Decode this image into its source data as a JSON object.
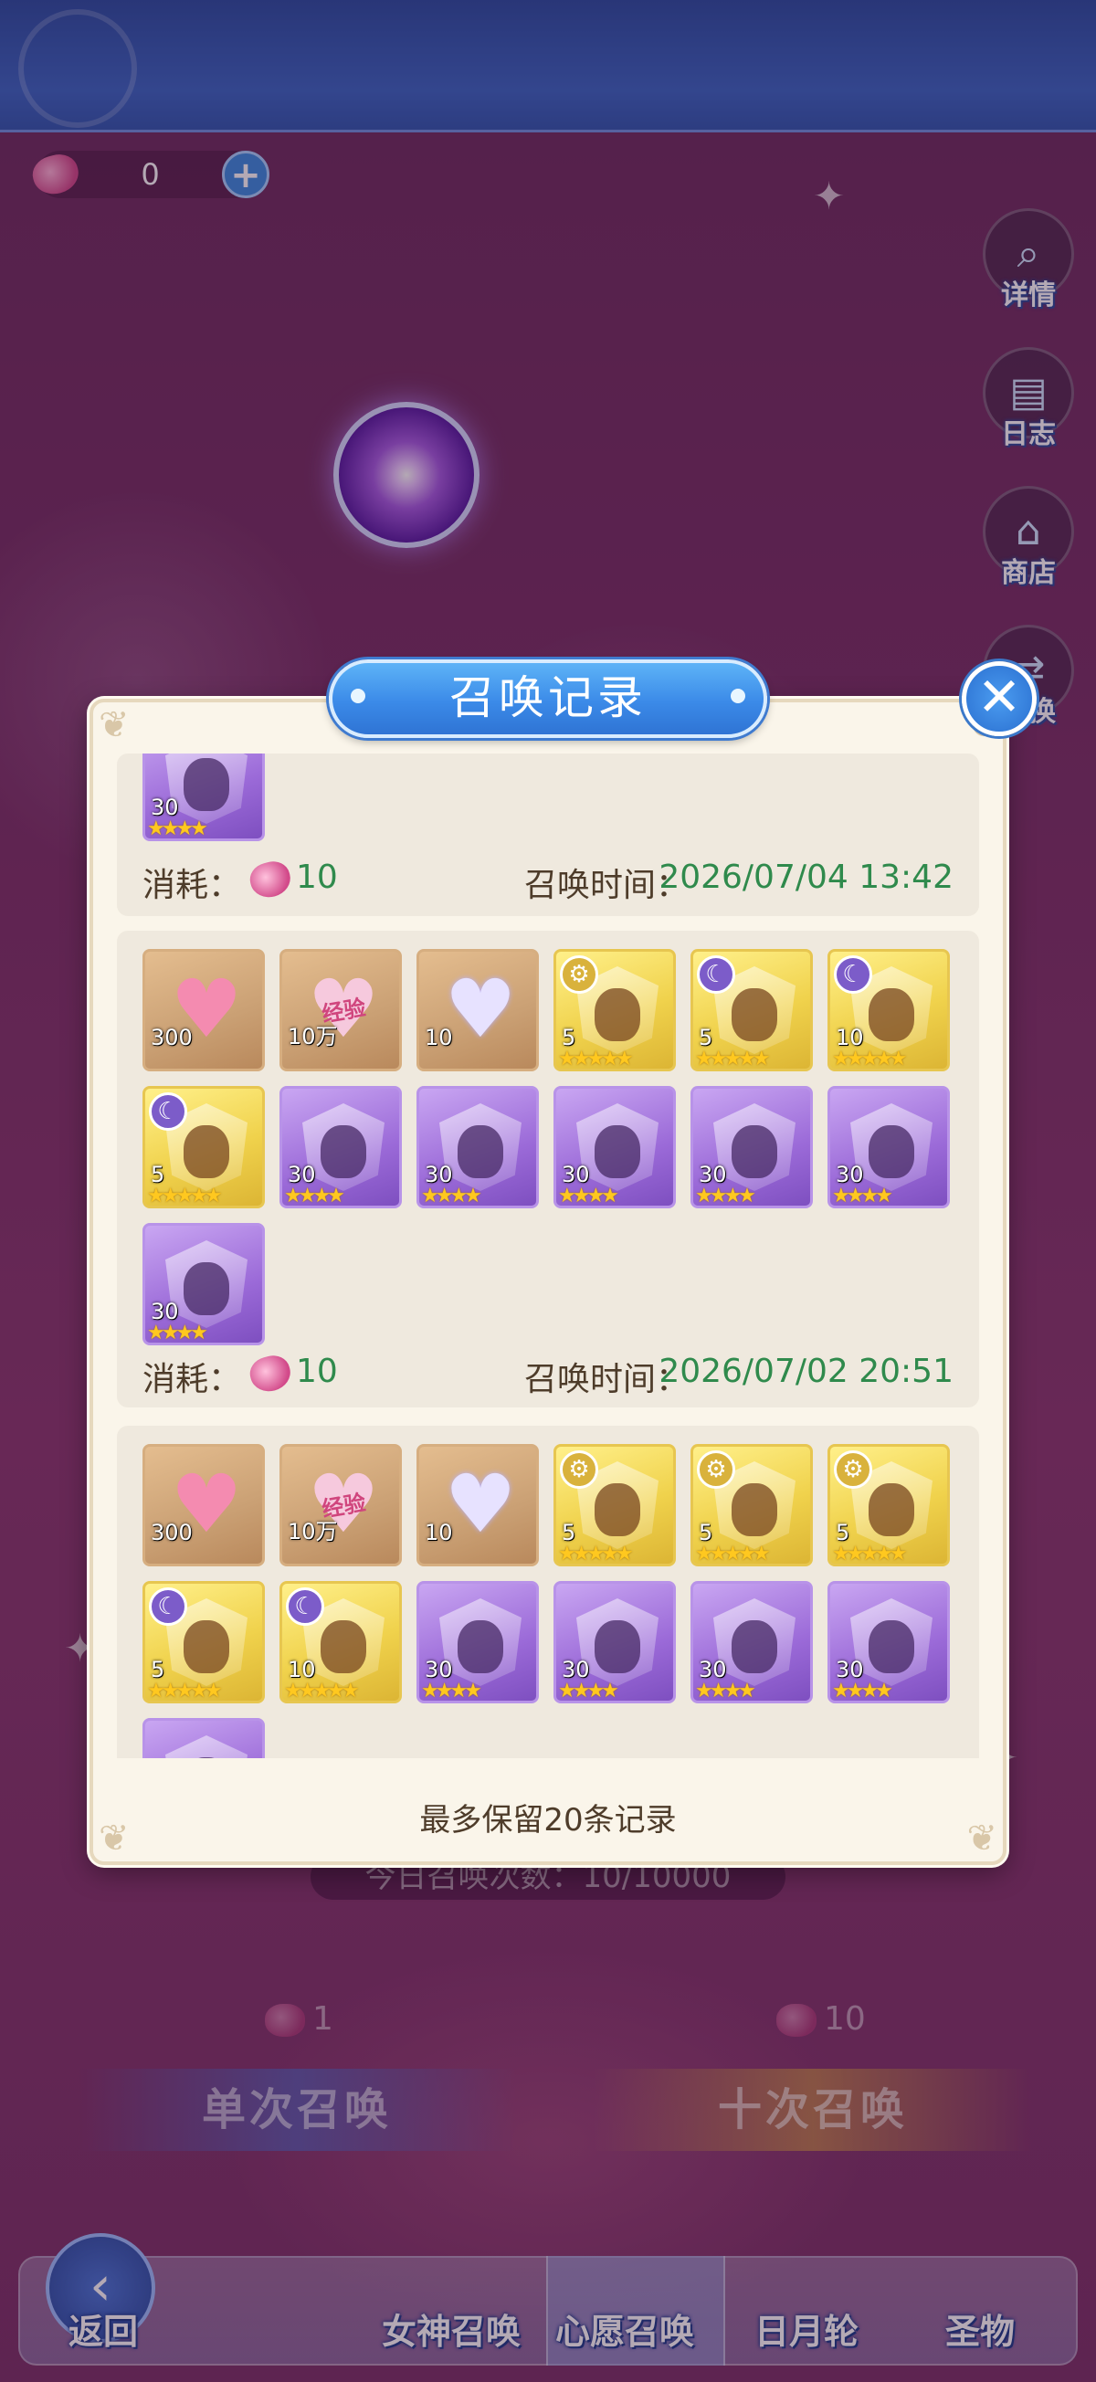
{
  "currency": {
    "amount": "0",
    "add_label": "+"
  },
  "side_menu": [
    {
      "label": "详情",
      "icon": "magnifier-icon"
    },
    {
      "label": "日志",
      "icon": "book-icon"
    },
    {
      "label": "商店",
      "icon": "shop-icon"
    },
    {
      "label": "兑换",
      "icon": "exchange-icon"
    }
  ],
  "daily_summons": "今日召唤次数：10/10000",
  "summon_buttons": {
    "single": {
      "label": "单次召唤",
      "cost": "1"
    },
    "ten": {
      "label": "十次召唤",
      "cost": "10"
    }
  },
  "bottom_nav": [
    {
      "label": "返回"
    },
    {
      "label": "女神召唤"
    },
    {
      "label": "心愿召唤",
      "active": true
    },
    {
      "label": "日月轮"
    },
    {
      "label": "圣物"
    }
  ],
  "modal": {
    "title": "召唤记录",
    "close_label": "✕",
    "cost_label": "消耗：",
    "time_label": "召唤时间：",
    "footer": "最多保留20条记录",
    "records": [
      {
        "cost": "10",
        "time": "2026/07/04 13:42",
        "items": [
          {
            "type": "purple",
            "qty": "30",
            "stars": "★★★★"
          }
        ]
      },
      {
        "cost": "10",
        "time": "2026/07/02 20:51",
        "items": [
          {
            "type": "brown",
            "kind": "pink-heart",
            "qty": "300",
            "stars": ""
          },
          {
            "type": "brown",
            "kind": "exp-heart",
            "qty": "10万",
            "stars": "",
            "text": "经验"
          },
          {
            "type": "brown",
            "kind": "crystal-heart",
            "qty": "10",
            "stars": ""
          },
          {
            "type": "gold",
            "badge": "gear",
            "qty": "5",
            "stars": "★★★★★"
          },
          {
            "type": "gold",
            "badge": "moon",
            "qty": "5",
            "stars": "★★★★★"
          },
          {
            "type": "gold",
            "badge": "moon",
            "qty": "10",
            "stars": "★★★★★"
          },
          {
            "type": "gold",
            "badge": "moon",
            "qty": "5",
            "stars": "★★★★★"
          },
          {
            "type": "purple",
            "qty": "30",
            "stars": "★★★★"
          },
          {
            "type": "purple",
            "qty": "30",
            "stars": "★★★★"
          },
          {
            "type": "purple",
            "qty": "30",
            "stars": "★★★★"
          },
          {
            "type": "purple",
            "qty": "30",
            "stars": "★★★★"
          },
          {
            "type": "purple",
            "qty": "30",
            "stars": "★★★★"
          },
          {
            "type": "purple",
            "qty": "30",
            "stars": "★★★★"
          }
        ]
      },
      {
        "cost": "",
        "time": "",
        "items": [
          {
            "type": "brown",
            "kind": "pink-heart",
            "qty": "300",
            "stars": ""
          },
          {
            "type": "brown",
            "kind": "exp-heart",
            "qty": "10万",
            "stars": "",
            "text": "经验"
          },
          {
            "type": "brown",
            "kind": "crystal-heart",
            "qty": "10",
            "stars": ""
          },
          {
            "type": "gold",
            "badge": "gear",
            "qty": "5",
            "stars": "★★★★★"
          },
          {
            "type": "gold",
            "badge": "gear",
            "qty": "5",
            "stars": "★★★★★"
          },
          {
            "type": "gold",
            "badge": "gear",
            "qty": "5",
            "stars": "★★★★★"
          },
          {
            "type": "gold",
            "badge": "moon",
            "qty": "5",
            "stars": "★★★★★"
          },
          {
            "type": "gold",
            "badge": "moon",
            "qty": "10",
            "stars": "★★★★★"
          },
          {
            "type": "purple",
            "qty": "30",
            "stars": "★★★★"
          },
          {
            "type": "purple",
            "qty": "30",
            "stars": "★★★★"
          },
          {
            "type": "purple",
            "qty": "30",
            "stars": "★★★★"
          },
          {
            "type": "purple",
            "qty": "30",
            "stars": "★★★★"
          },
          {
            "type": "purple",
            "qty": "",
            "stars": ""
          }
        ]
      }
    ]
  }
}
